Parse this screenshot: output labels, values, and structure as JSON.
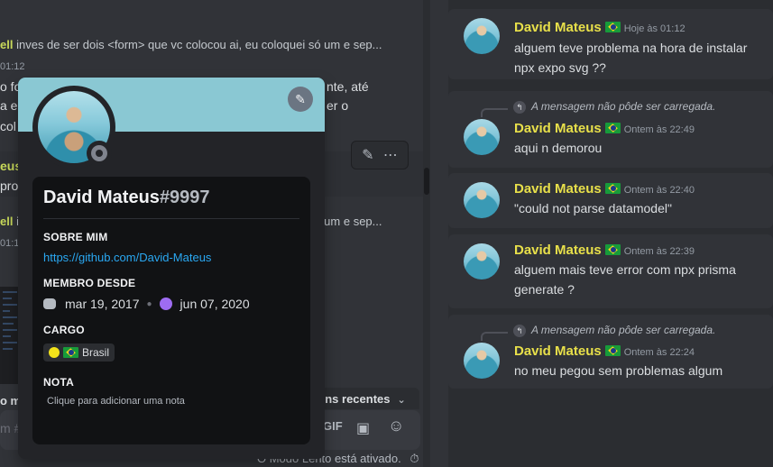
{
  "left_chat": {
    "line1_user": "ell",
    "line1_text": "inves de ser dois <form> que vc colocou ai, eu coloquei só um e sep...",
    "time1": "01:12",
    "frag1": "o fo",
    "frag2": "a er",
    "frag3": "col",
    "frag1_right": "nte, até",
    "frag2_right": "er o",
    "user2": "eus",
    "frag4": "pro",
    "line2_user": "ell",
    "line2_text": "inves de ser dois <form> que vc colocou ai, eu coloquei só um e sep...",
    "time2": "01:1",
    "composer_tag": "o m",
    "composer_placeholder": "m #",
    "recents_label": "ens recentes",
    "gif_label": "GIF",
    "slowmode_text": "O Modo Lento está ativado."
  },
  "popout": {
    "username": "David Mateus",
    "discriminator": "#9997",
    "about_title": "SOBRE MIM",
    "about_link": "https://github.com/David-Mateus",
    "member_since_title": "MEMBRO DESDE",
    "discord_since": "mar 19, 2017",
    "server_since": "jun 07, 2020",
    "role_title": "CARGO",
    "role_name": "Brasil",
    "note_title": "NOTA",
    "note_placeholder": "Clique para adicionar uma nota"
  },
  "thread": {
    "reply_unavailable": "A mensagem não pôde ser carregada.",
    "messages": [
      {
        "author": "David Mateus",
        "time": "Hoje às 01:12",
        "text": "alguem teve problema na hora de instalar npx expo svg ??"
      },
      {
        "author": "David Mateus",
        "time": "Ontem às 22:49",
        "text": "aqui n demorou"
      },
      {
        "author": "David Mateus",
        "time": "Ontem às 22:40",
        "text": "\"could not parse datamodel\""
      },
      {
        "author": "David Mateus",
        "time": "Ontem às 22:39",
        "text": "alguem mais teve error com npx prisma generate ?"
      },
      {
        "author": "David Mateus",
        "time": "Ontem às 22:24",
        "text": "no meu pegou sem problemas algum"
      }
    ]
  },
  "colors": {
    "username_yellow": "#e8e04a",
    "link_blue": "#2aa8f2",
    "banner": "#8ac8d3",
    "nitro_purple": "#9e6cf2"
  },
  "icons": [
    "edit-pencil-icon",
    "more-dots-icon",
    "discord-logo-icon",
    "server-boost-icon",
    "reply-arrow-icon",
    "gif-icon",
    "sticker-icon",
    "emoji-icon",
    "timer-icon",
    "chevron-down-icon",
    "brazil-flag-icon"
  ]
}
